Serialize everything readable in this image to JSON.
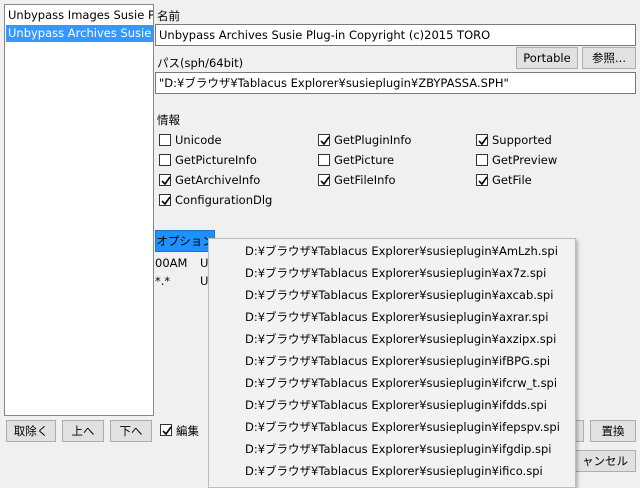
{
  "plugin_list": {
    "items": [
      {
        "label": "Unbypass Images Susie Plug-in",
        "selected": false
      },
      {
        "label": "Unbypass Archives Susie Plug-in",
        "selected": true
      }
    ]
  },
  "left_buttons": {
    "remove": "取除く",
    "up": "上へ",
    "down": "下へ"
  },
  "edit_checkbox": {
    "label": "編集",
    "checked": true
  },
  "name_section": {
    "label": "名前",
    "value": "Unbypass Archives Susie Plug-in Copyright (c)2015 TORO"
  },
  "path_section": {
    "label": "パス(sph/64bit)",
    "value": "\"D:¥ブラウザ¥Tablacus Explorer¥susieplugin¥ZBYPASSA.SPH\"",
    "portable_label": "Portable",
    "browse_label": "参照..."
  },
  "info_section": {
    "label": "情報",
    "checkboxes": [
      {
        "label": "Unicode",
        "checked": false
      },
      {
        "label": "GetPluginInfo",
        "checked": true
      },
      {
        "label": "Supported",
        "checked": true
      },
      {
        "label": "GetPictureInfo",
        "checked": false
      },
      {
        "label": "GetPicture",
        "checked": false
      },
      {
        "label": "GetPreview",
        "checked": false
      },
      {
        "label": "GetArchiveInfo",
        "checked": true
      },
      {
        "label": "GetFileInfo",
        "checked": true
      },
      {
        "label": "GetFile",
        "checked": true
      },
      {
        "label": "ConfigurationDlg",
        "checked": true
      }
    ]
  },
  "options_button": "オプション",
  "partial_text": [
    "00AM",
    "U",
    "*.*",
    "U"
  ],
  "replace_button": "置換",
  "cancel_button": "ャンセル",
  "dropdown": {
    "items": [
      "D:¥ブラウザ¥Tablacus Explorer¥susieplugin¥AmLzh.spi",
      "D:¥ブラウザ¥Tablacus Explorer¥susieplugin¥ax7z.spi",
      "D:¥ブラウザ¥Tablacus Explorer¥susieplugin¥axcab.spi",
      "D:¥ブラウザ¥Tablacus Explorer¥susieplugin¥axrar.spi",
      "D:¥ブラウザ¥Tablacus Explorer¥susieplugin¥axzipx.spi",
      "D:¥ブラウザ¥Tablacus Explorer¥susieplugin¥ifBPG.spi",
      "D:¥ブラウザ¥Tablacus Explorer¥susieplugin¥ifcrw_t.spi",
      "D:¥ブラウザ¥Tablacus Explorer¥susieplugin¥ifdds.spi",
      "D:¥ブラウザ¥Tablacus Explorer¥susieplugin¥ifepspv.spi",
      "D:¥ブラウザ¥Tablacus Explorer¥susieplugin¥ifgdip.spi",
      "D:¥ブラウザ¥Tablacus Explorer¥susieplugin¥ifico.spi"
    ]
  },
  "colors": {
    "selection": "#3399ff",
    "options_button": "#1e90ff",
    "window_bg": "#f0f0f0"
  }
}
